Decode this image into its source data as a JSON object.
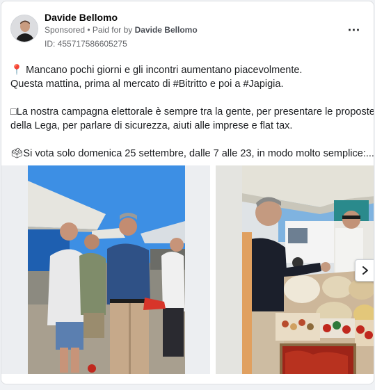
{
  "post": {
    "author": "Davide Bellomo",
    "sponsored_label": "Sponsored",
    "separator": " • ",
    "paid_for_prefix": "Paid for by ",
    "paid_for_name": "Davide Bellomo",
    "ad_id": "ID: 455717586605275",
    "more_icon": "⋯"
  },
  "text": {
    "line1": "📍 Mancano pochi giorni e gli incontri aumentano piacevolmente.",
    "line2": "Questa mattina, prima al mercato di #Bitritto e poi a #Japigia.",
    "line3": "□La nostra campagna elettorale è sempre tra la gente, per presentare le proposte",
    "line4": "della Lega, per parlare di sicurezza, aiuti alle imprese e flat tax.",
    "line5": "🗳Si vota solo domenica 25 settembre, dalle 7 alle 23, in modo molto semplice:..."
  },
  "icons": {
    "avatar": "person-avatar-icon",
    "more": "more-options-icon",
    "next": "chevron-right-icon"
  },
  "colors": {
    "sky": "#3b8fe6",
    "tent_white": "#e8e8e4",
    "ground": "#a89f8f",
    "tent_blue": "#1e5fb0",
    "accent_red": "#c0281e"
  }
}
